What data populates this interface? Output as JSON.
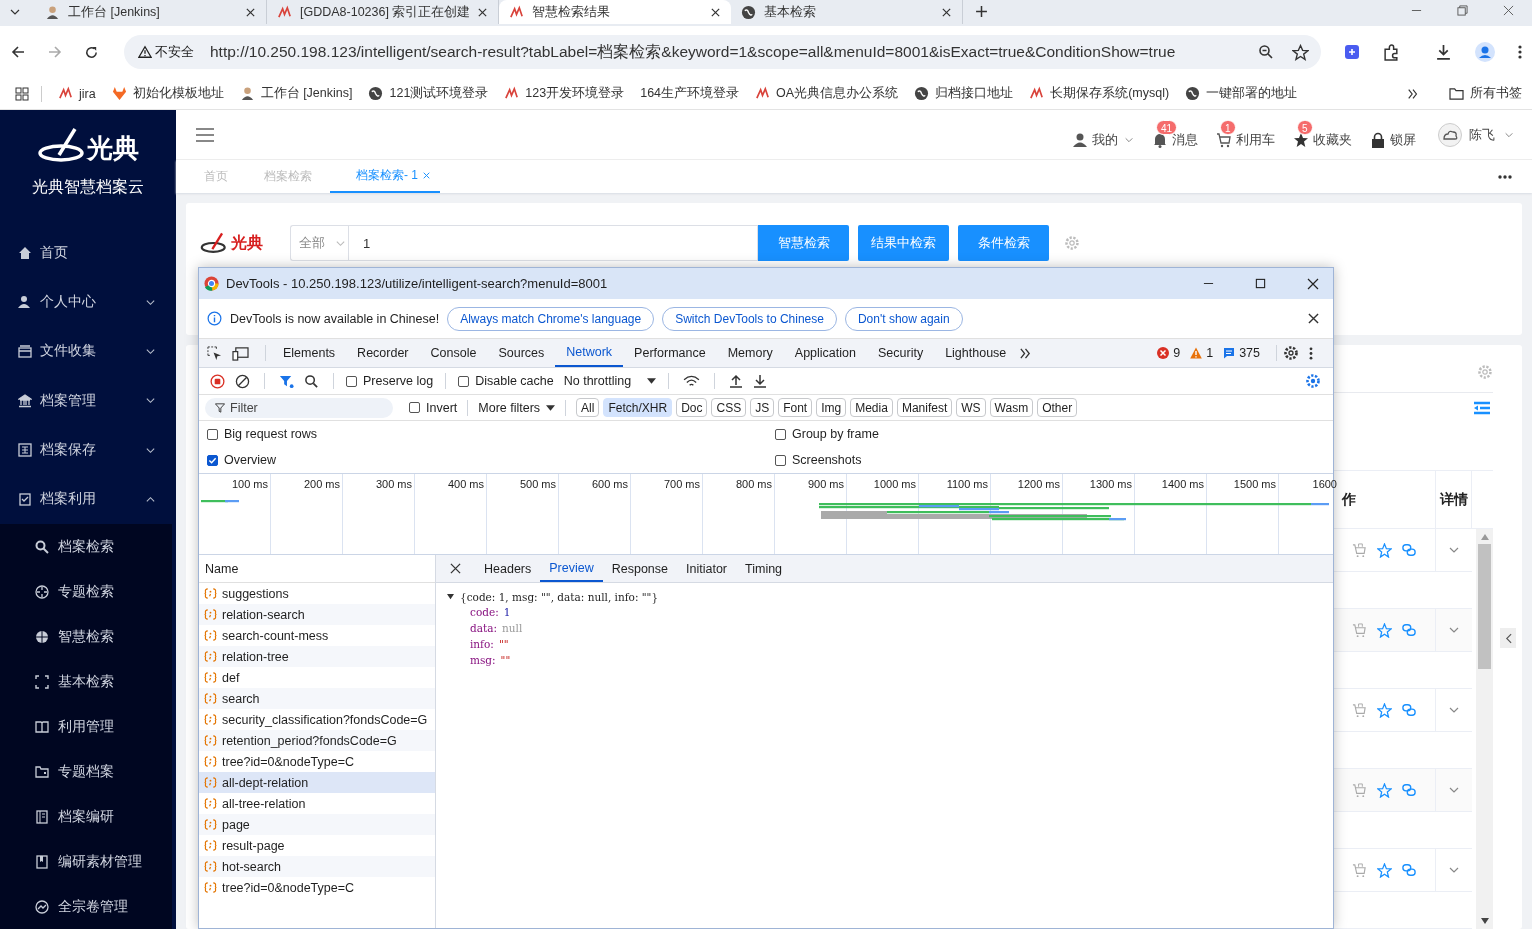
{
  "browser": {
    "tabs": [
      {
        "title": "工作台 [Jenkins]",
        "selected": false
      },
      {
        "title": "[GDDA8-10236] 索引正在创建",
        "selected": false
      },
      {
        "title": "智慧检索结果",
        "selected": true
      },
      {
        "title": "基本检索",
        "selected": false
      }
    ],
    "security_label": "不安全",
    "url": "http://10.250.198.123/intelligent/search-result?tabLabel=档案检索&keyword=1&scope=all&menuId=8001&isExact=true&ConditionShow=true",
    "bookmarks": [
      "jira",
      "初始化模板地址",
      "工作台 [Jenkins]",
      "121测试环境登录",
      "123开发环境登录",
      "164生产环境登录",
      "OA光典信息办公系统",
      "归档接口地址",
      "长期保存系统(mysql)",
      "一键部署的地址"
    ],
    "all_bookmarks": "所有书签"
  },
  "sidebar": {
    "logo_text": "光典",
    "app_name": "光典智慧档案云",
    "items": [
      {
        "label": "首页",
        "kind": "link"
      },
      {
        "label": "个人中心",
        "kind": "group",
        "expanded": false
      },
      {
        "label": "文件收集",
        "kind": "group",
        "expanded": false
      },
      {
        "label": "档案管理",
        "kind": "group",
        "expanded": false
      },
      {
        "label": "档案保存",
        "kind": "group",
        "expanded": false
      },
      {
        "label": "档案利用",
        "kind": "group",
        "expanded": true,
        "children": [
          "档案检索",
          "专题检索",
          "智慧检索",
          "基本检索",
          "利用管理",
          "专题档案",
          "档案编研",
          "编研素材管理",
          "全宗卷管理"
        ]
      }
    ]
  },
  "header": {
    "items": [
      {
        "label": "我的"
      },
      {
        "label": "消息",
        "badge": "41"
      },
      {
        "label": "利用车",
        "badge": "1"
      },
      {
        "label": "收藏夹",
        "badge": "5"
      },
      {
        "label": "锁屏"
      }
    ],
    "user": "陈飞"
  },
  "page_tabs": [
    {
      "label": "首页",
      "selected": false
    },
    {
      "label": "档案检索",
      "selected": false
    },
    {
      "label": "档案检索- 1",
      "selected": true
    }
  ],
  "search": {
    "logo_text": "光典",
    "scope": "全部",
    "keyword": "1",
    "buttons": [
      "智慧检索",
      "结果中检索",
      "条件检索"
    ]
  },
  "results_table": {
    "columns": [
      "作",
      "详情"
    ],
    "rows": [
      {
        "expanded": false
      },
      {
        "expanded": false
      },
      {
        "expanded": false
      },
      {
        "expanded": false
      },
      {
        "expanded": false
      }
    ]
  },
  "devtools": {
    "title": "DevTools - 10.250.198.123/utilize/intelligent-search?menuId=8001",
    "infobar": {
      "message": "DevTools is now available in Chinese!",
      "buttons": [
        "Always match Chrome's language",
        "Switch DevTools to Chinese",
        "Don't show again"
      ]
    },
    "panels": [
      {
        "label": "Elements",
        "selected": false
      },
      {
        "label": "Recorder",
        "selected": false
      },
      {
        "label": "Console",
        "selected": false
      },
      {
        "label": "Sources",
        "selected": false
      },
      {
        "label": "Network",
        "selected": true
      },
      {
        "label": "Performance",
        "selected": false
      },
      {
        "label": "Memory",
        "selected": false
      },
      {
        "label": "Application",
        "selected": false
      },
      {
        "label": "Security",
        "selected": false
      },
      {
        "label": "Lighthouse",
        "selected": false
      }
    ],
    "errors": "9",
    "warnings": "1",
    "messages": "375",
    "preserve_log": {
      "label": "Preserve log",
      "checked": false
    },
    "disable_cache": {
      "label": "Disable cache",
      "checked": false
    },
    "throttling": "No throttling",
    "filter_placeholder": "Filter",
    "invert": {
      "label": "Invert",
      "checked": false
    },
    "more_filters": "More filters",
    "type_filters": [
      {
        "label": "All",
        "selected": false
      },
      {
        "label": "Fetch/XHR",
        "selected": true
      },
      {
        "label": "Doc",
        "selected": false
      },
      {
        "label": "CSS",
        "selected": false
      },
      {
        "label": "JS",
        "selected": false
      },
      {
        "label": "Font",
        "selected": false
      },
      {
        "label": "Img",
        "selected": false
      },
      {
        "label": "Media",
        "selected": false
      },
      {
        "label": "Manifest",
        "selected": false
      },
      {
        "label": "WS",
        "selected": false
      },
      {
        "label": "Wasm",
        "selected": false
      },
      {
        "label": "Other",
        "selected": false
      }
    ],
    "options": [
      {
        "label": "Big request rows",
        "checked": false
      },
      {
        "label": "Group by frame",
        "checked": false
      },
      {
        "label": "Overview",
        "checked": true
      },
      {
        "label": "Screenshots",
        "checked": false
      }
    ],
    "timeline_ticks": [
      "100 ms",
      "200 ms",
      "300 ms",
      "400 ms",
      "500 ms",
      "600 ms",
      "700 ms",
      "800 ms",
      "900 ms",
      "1000 ms",
      "1100 ms",
      "1200 ms",
      "1300 ms",
      "1400 ms",
      "1500 ms",
      "1600"
    ],
    "name_header": "Name",
    "requests": [
      {
        "name": "suggestions",
        "selected": false
      },
      {
        "name": "relation-search",
        "selected": false
      },
      {
        "name": "search-count-mess",
        "selected": false
      },
      {
        "name": "relation-tree",
        "selected": false
      },
      {
        "name": "def",
        "selected": false
      },
      {
        "name": "search",
        "selected": false
      },
      {
        "name": "security_classification?fondsCode=G",
        "selected": false
      },
      {
        "name": "retention_period?fondsCode=G",
        "selected": false
      },
      {
        "name": "tree?id=0&nodeType=C",
        "selected": false
      },
      {
        "name": "all-dept-relation",
        "selected": true
      },
      {
        "name": "all-tree-relation",
        "selected": false
      },
      {
        "name": "page",
        "selected": false
      },
      {
        "name": "result-page",
        "selected": false
      },
      {
        "name": "hot-search",
        "selected": false
      },
      {
        "name": "tree?id=0&nodeType=C",
        "selected": false
      }
    ],
    "detail_tabs": [
      {
        "label": "Headers",
        "selected": false
      },
      {
        "label": "Preview",
        "selected": true
      },
      {
        "label": "Response",
        "selected": false
      },
      {
        "label": "Initiator",
        "selected": false
      },
      {
        "label": "Timing",
        "selected": false
      }
    ],
    "preview": {
      "summary": "{code: 1, msg: \"\", data: null, info: \"\"}",
      "expanded": true,
      "fields": [
        {
          "key": "code:",
          "value": "1",
          "kind": "number"
        },
        {
          "key": "data:",
          "value": "null",
          "kind": "null"
        },
        {
          "key": "info:",
          "value": "\"\"",
          "kind": "string"
        },
        {
          "key": "msg:",
          "value": "\"\"",
          "kind": "string"
        }
      ]
    }
  }
}
